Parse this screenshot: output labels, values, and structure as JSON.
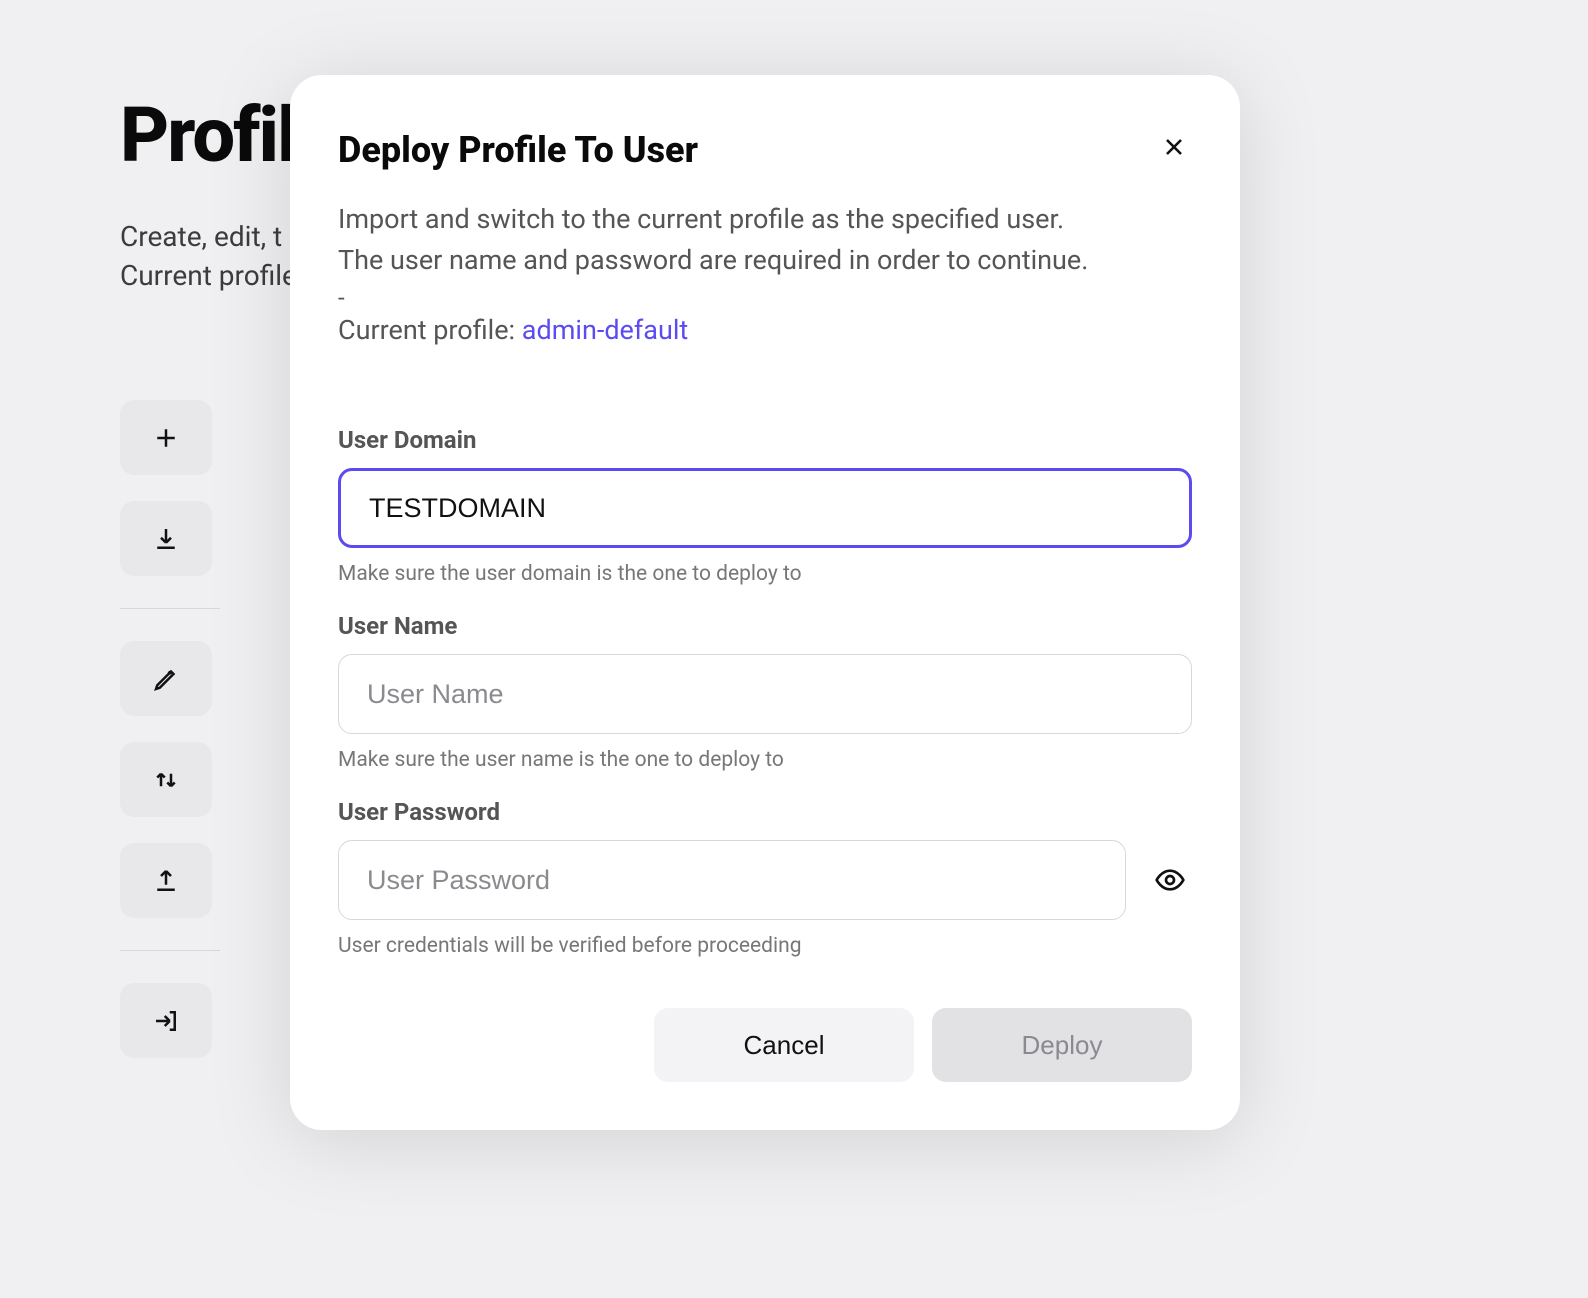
{
  "bg": {
    "title": "Profiles",
    "sub1": "Create, edit, t",
    "sub2": "Current profile"
  },
  "modal": {
    "title": "Deploy Profile To User",
    "desc_line1": "Import and switch to the current profile as the specified user.",
    "desc_line2": "The user name and password are required in order to continue.",
    "dash": "-",
    "profile_prefix": "Current profile: ",
    "profile_name": "admin-default",
    "fields": {
      "domain": {
        "label": "User Domain",
        "value": "TESTDOMAIN",
        "hint": "Make sure the user domain is the one to deploy to"
      },
      "username": {
        "label": "User Name",
        "value": "",
        "placeholder": "User Name",
        "hint": "Make sure the user name is the one to deploy to"
      },
      "password": {
        "label": "User Password",
        "value": "",
        "placeholder": "User Password",
        "hint": "User credentials will be verified before proceeding"
      }
    },
    "buttons": {
      "cancel": "Cancel",
      "deploy": "Deploy"
    }
  },
  "icons": {
    "sidebar": [
      "plus",
      "download",
      "pencil",
      "updown",
      "upload",
      "login"
    ]
  }
}
